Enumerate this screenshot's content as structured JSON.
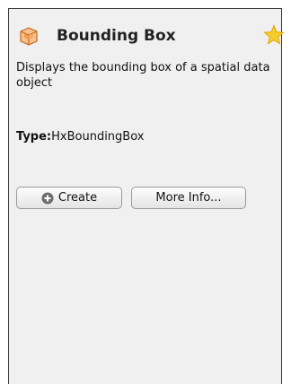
{
  "module": {
    "title": "Bounding Box",
    "description": "Displays the bounding box of a spatial data object",
    "type_label": "Type:",
    "type_value": "HxBoundingBox"
  },
  "buttons": {
    "create_label": "Create",
    "more_info_label": "More Info..."
  },
  "icons": {
    "module": "bounding-box-cube-icon",
    "favorite": "star-icon",
    "create": "plus-circle-icon"
  },
  "colors": {
    "panel_background": "#f0f0f0",
    "star": "#f5c518",
    "module_icon": "#e8923a"
  }
}
